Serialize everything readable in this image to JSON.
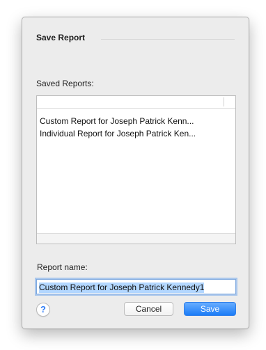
{
  "dialog": {
    "title": "Save Report",
    "saved_reports_label": "Saved Reports:",
    "saved_reports": [
      "Custom Report for Joseph Patrick Kenn...",
      "Individual Report for Joseph Patrick Ken..."
    ],
    "report_name_label": "Report name:",
    "report_name_value": "Custom Report for Joseph Patrick Kennedy1",
    "help_label": "?",
    "cancel_label": "Cancel",
    "save_label": "Save"
  },
  "colors": {
    "accent": "#1b7cf7",
    "selection": "#b3d7ff",
    "panel": "#ececec"
  },
  "icons": {
    "help": "question-mark-icon"
  }
}
